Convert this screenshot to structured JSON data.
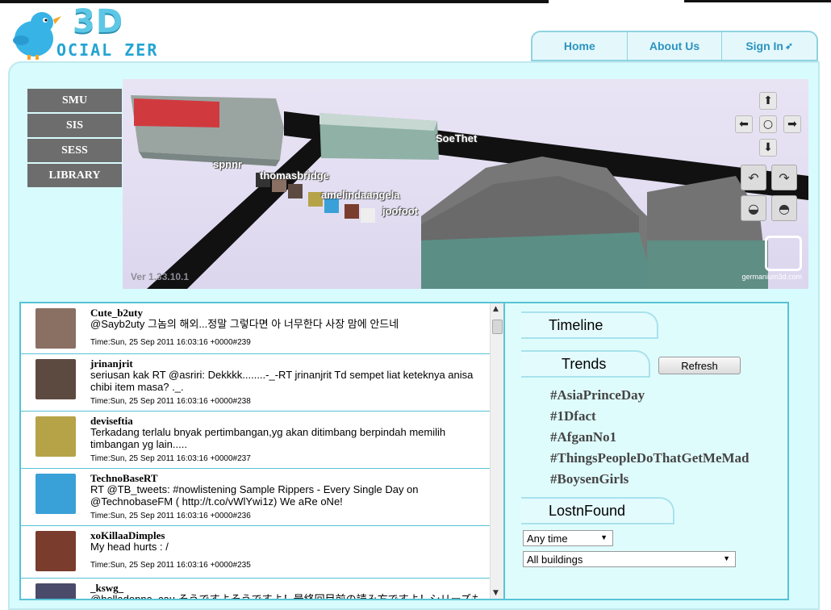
{
  "logo": {
    "three_d": "3D",
    "rest": "OCIAL ZER"
  },
  "nav": {
    "items": [
      {
        "label": "Home"
      },
      {
        "label": "About Us"
      },
      {
        "label": "Sign In"
      }
    ]
  },
  "buildings": [
    {
      "label": "SMU"
    },
    {
      "label": "SIS"
    },
    {
      "label": "SESS"
    },
    {
      "label": "LIBRARY"
    }
  ],
  "view3d": {
    "version": "Ver 1.33.10.1",
    "watermark": "germanium3d.com",
    "labels": [
      "SoeThet",
      "spnnr",
      "thomasbridge",
      "amelindaangela",
      "joofoot"
    ]
  },
  "controls": {
    "up": "up-arrow",
    "down": "down-arrow",
    "left": "left-arrow",
    "right": "right-arrow",
    "center": "center"
  },
  "tweets": [
    {
      "user": "Cute_b2uty",
      "text": "@Sayb2uty 그놈의 해외...정말 그렇다면 아 너무한다 사장 맘에 안드네",
      "time": "Time:Sun, 25 Sep 2011 16:03:16 +0000#239",
      "avatar_color": "#8a6f63"
    },
    {
      "user": "jrinanjrit",
      "text": "seriusan kak RT @asriri: Dekkkk........-_-RT jrinanjrit Td sempet liat keteknya anisa chibi item masa? ._.",
      "time": "Time:Sun, 25 Sep 2011 16:03:16 +0000#238",
      "avatar_color": "#5c4a40"
    },
    {
      "user": "deviseftia",
      "text": "Terkadang terlalu bnyak pertimbangan,yg akan ditimbang berpindah memilih timbangan yg lain.....",
      "time": "Time:Sun, 25 Sep 2011 16:03:16 +0000#237",
      "avatar_color": "#b6a348"
    },
    {
      "user": "TechnoBaseRT",
      "text": "RT @TB_tweets: #nowlistening Sample Rippers - Every Single Day on @TechnobaseFM ( http://t.co/vWlYwi1z) We aRe oNe!",
      "time": "Time:Sun, 25 Sep 2011 16:03:16 +0000#236",
      "avatar_color": "#3aa1d8"
    },
    {
      "user": "xoKillaaDimples",
      "text": "My head hurts : /",
      "time": "Time:Sun, 25 Sep 2011 16:03:16 +0000#235",
      "avatar_color": "#7a3c2c"
    },
    {
      "user": "_kswg_",
      "text": "@helladonna_cau そうですよそうですよ！最終回目前の読み方ですよ！シリーズも途中",
      "time": "",
      "avatar_color": "#4a4a6a"
    }
  ],
  "right": {
    "timeline_tab": "Timeline",
    "trends_tab": "Trends",
    "refresh": "Refresh",
    "trends": [
      "#AsiaPrinceDay",
      "#1Dfact",
      "#AfganNo1",
      "#ThingsPeopleDoThatGetMeMad",
      "#BoysenGirls"
    ],
    "lostnfound_tab": "LostnFound",
    "time_select": "Any time",
    "building_select": "All buildings"
  }
}
